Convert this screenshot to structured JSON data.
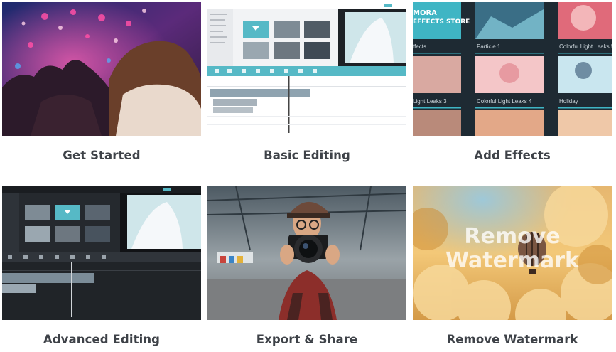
{
  "cards": [
    {
      "title": "Get Started"
    },
    {
      "title": "Basic Editing"
    },
    {
      "title": "Add Effects"
    },
    {
      "title": "Advanced Editing"
    },
    {
      "title": "Export & Share"
    },
    {
      "title": "Remove Watermark"
    }
  ],
  "effects_store": {
    "banner_line1": "MORA",
    "banner_line2": "EFFECTS STORE",
    "items": [
      "ffects",
      "Particle 1",
      "Colorful Light Leaks 5",
      "Light Leaks 3",
      "Colorful Light Leaks 4",
      "Holiday"
    ]
  },
  "watermark": {
    "line1": "Remove",
    "line2": "Watermark"
  },
  "colors": {
    "caption": "#3e4248",
    "editor_accent": "#56b9c6",
    "editor_dark": "#25292e",
    "effects_bg": "#1e2a33",
    "effects_accent": "#3fb5c4"
  }
}
